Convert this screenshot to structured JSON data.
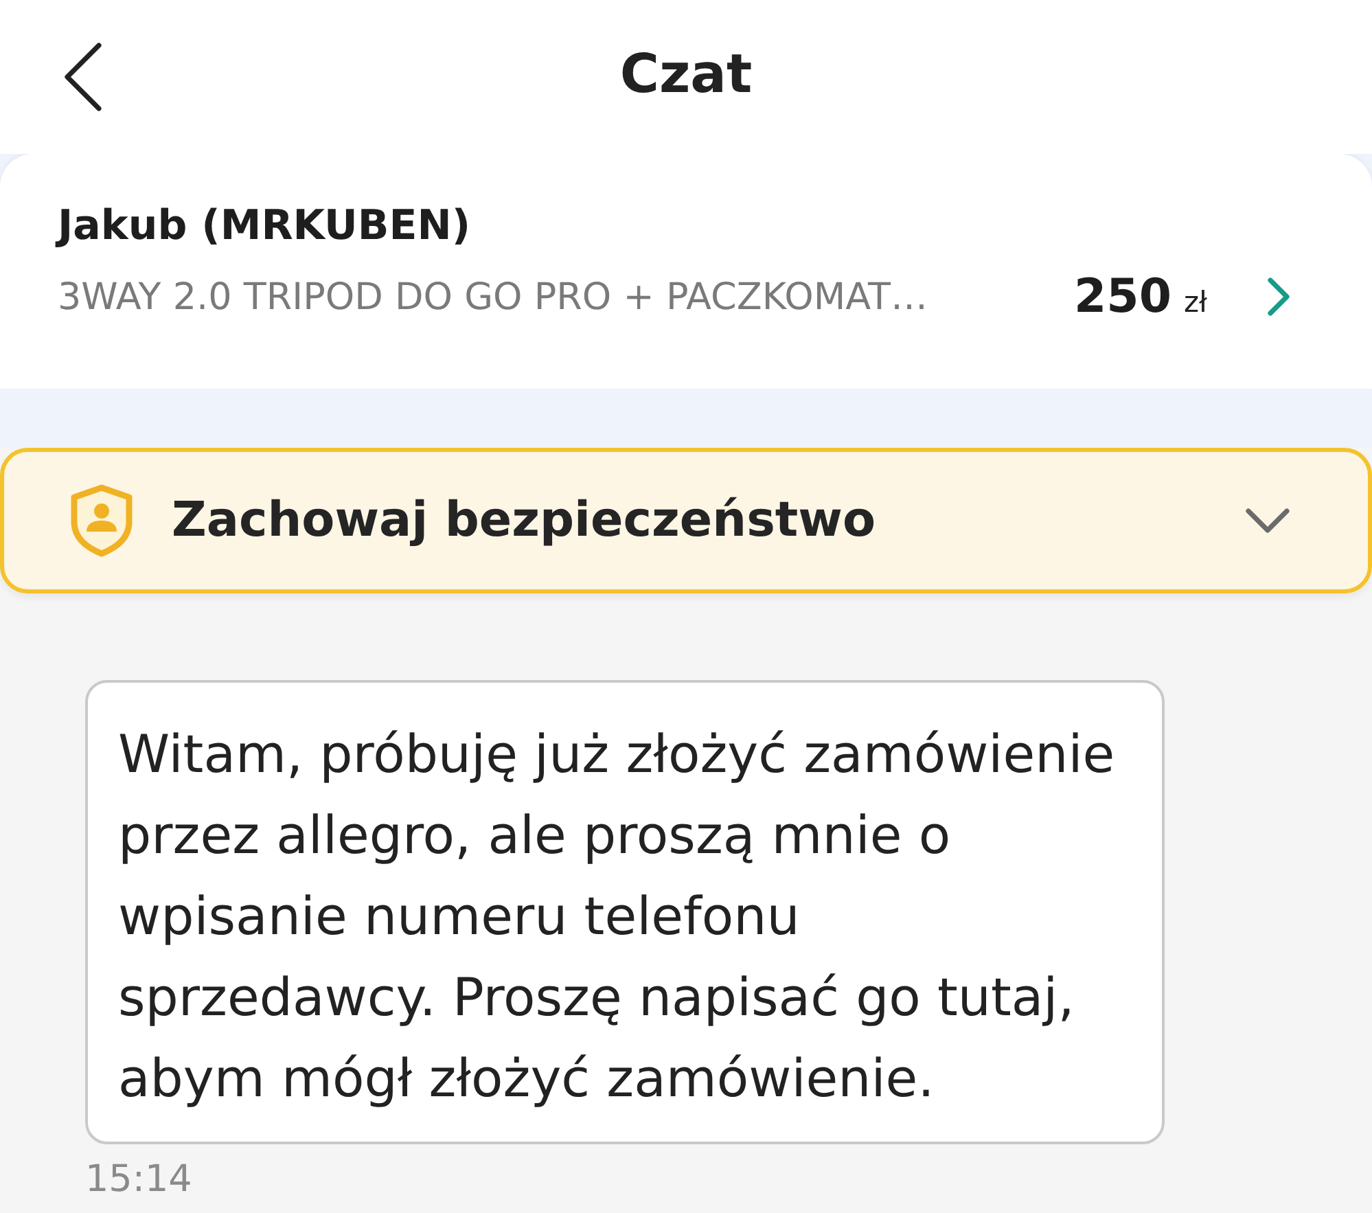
{
  "header": {
    "title": "Czat"
  },
  "listing": {
    "seller": "Jakub (MRKUBEN)",
    "item_title": "3WAY 2.0 TRIPOD DO GO PRO + PACZKOMAT…",
    "price": "250",
    "currency": "zł"
  },
  "safety_banner": {
    "label": "Zachowaj bezpieczeństwo",
    "expanded": false
  },
  "messages": [
    {
      "kind": "incoming",
      "text": "Witam, próbuję już złożyć zamówienie przez allegro, ale proszą mnie o wpisanie numeru telefonu sprzedawcy. Proszę napisać go tutaj, abym mógł złożyć zamówienie.",
      "time": "15:14"
    }
  ]
}
